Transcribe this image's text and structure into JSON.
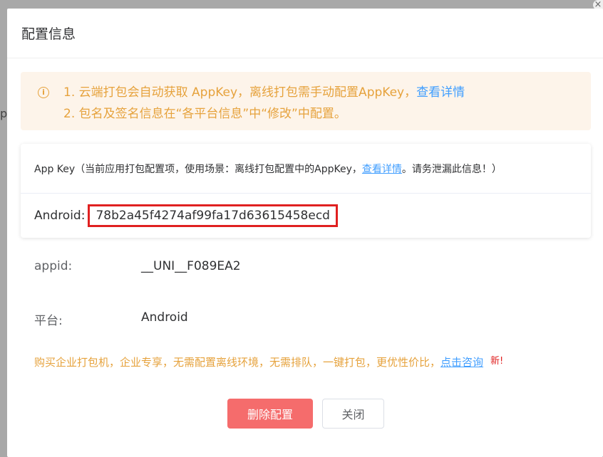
{
  "background": {
    "fragment": "p"
  },
  "dialog": {
    "title": "配置信息"
  },
  "notice": {
    "line1_text": "1. 云端打包会自动获取 AppKey，离线打包需手动配置AppKey，",
    "line1_link": "查看详情",
    "line2_text": "2. 包名及签名信息在“各平台信息”中“修改”中配置。"
  },
  "appkey_card": {
    "head_text": "App Key（当前应用打包配置项，使用场景：离线打包配置中的AppKey，",
    "head_link": "查看详情",
    "head_suffix": "。请务泄漏此信息！）",
    "platform_label": "Android:",
    "key_value": "78b2a45f4274af99fa17d63615458ecd"
  },
  "info": {
    "appid_label": "appid:",
    "appid_value": "__UNI__F089EA2",
    "platform_label": "平台:",
    "platform_value": "Android"
  },
  "promo": {
    "text": "购买企业打包机，企业专享，无需配置离线环境，无需排队，一键打包，更优性价比，",
    "link": "点击咨询",
    "badge": "新!"
  },
  "buttons": {
    "delete_label": "删除配置",
    "close_label": "关闭"
  },
  "colors": {
    "warning": "#e6a23c",
    "link": "#409eff",
    "danger": "#f56c6c",
    "highlight": "#e02020"
  }
}
